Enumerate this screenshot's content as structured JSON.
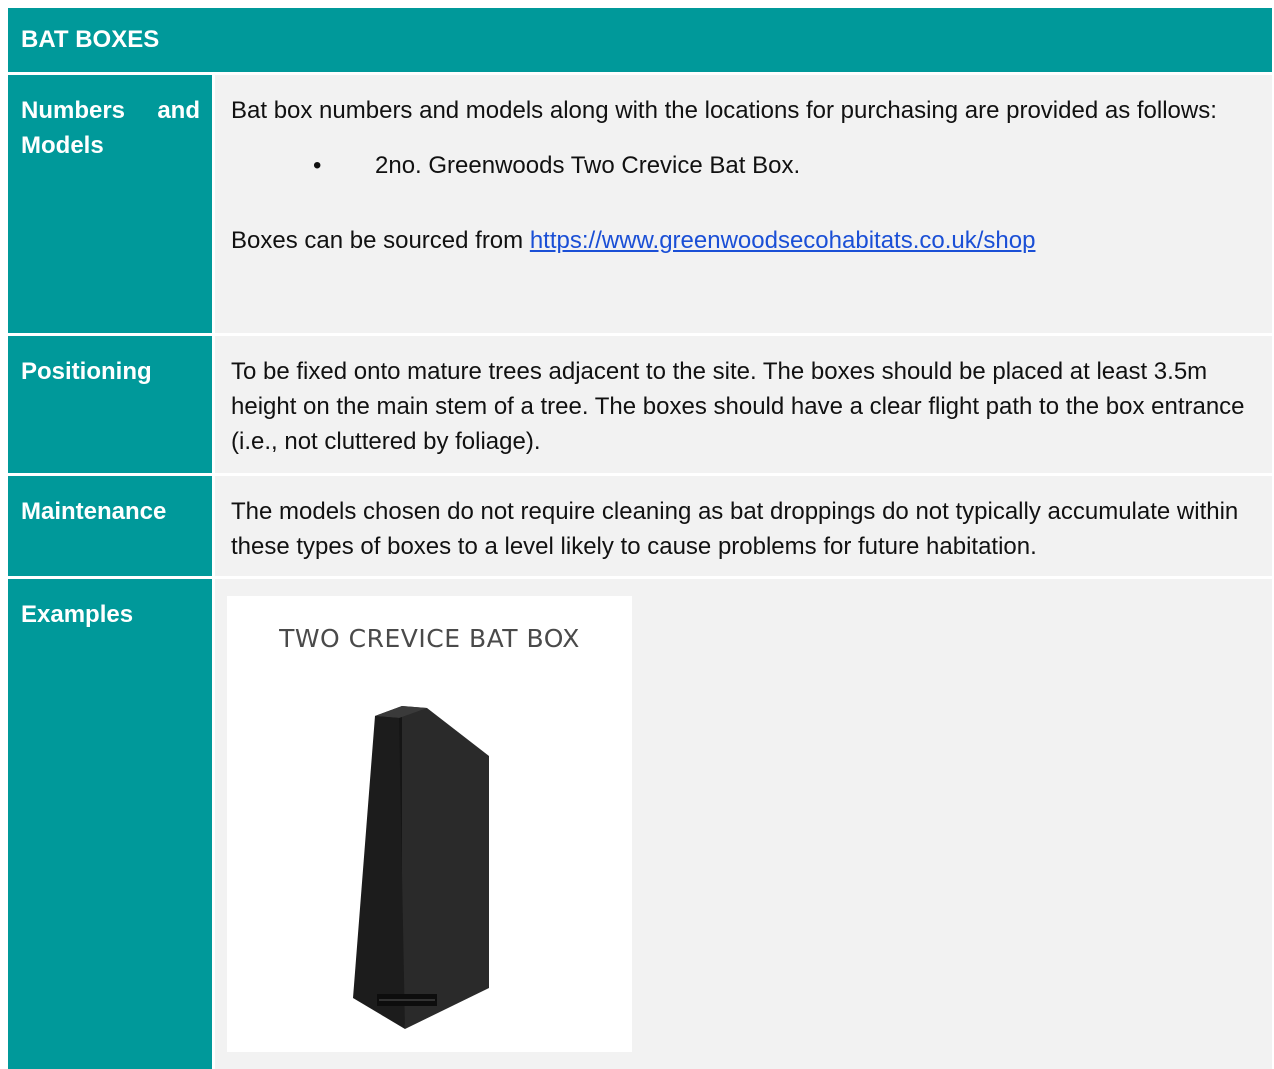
{
  "header": {
    "title": "BAT BOXES"
  },
  "rows": [
    {
      "label": "Numbers and Models",
      "intro": "Bat box numbers and models along with the locations for purchasing are provided as follows:",
      "bullet_symbol": "•",
      "bullet_text": "2no. Greenwoods Two Crevice Bat Box.",
      "source_prefix": "Boxes can be sourced from ",
      "source_link": "https://www.greenwoodsecohabitats.co.uk/shop"
    },
    {
      "label": "Positioning",
      "text": "To be fixed onto mature trees adjacent to the site. The boxes should be placed at least 3.5m height on the main stem of a tree. The boxes should have a clear flight path to the box entrance (i.e., not cluttered by foliage)."
    },
    {
      "label": "Maintenance",
      "text": "The models chosen do not require cleaning as bat droppings do not typically accumulate within these types of boxes to a level likely to cause problems for future habitation."
    },
    {
      "label": "Examples",
      "image_caption": "TWO CREVICE BAT BOX"
    }
  ],
  "colors": {
    "teal": "#00999a",
    "content_bg": "#f2f2f2",
    "link": "#1a4fd6"
  }
}
